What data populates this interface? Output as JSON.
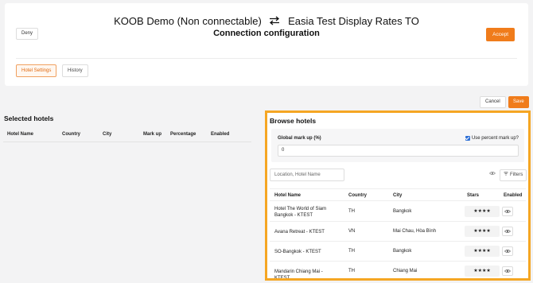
{
  "header": {
    "connection_from": "KOOB Demo (Non connectable)",
    "connection_to": "Easia Test Display Rates TO",
    "subtitle": "Connection configuration",
    "deny_label": "Deny",
    "accept_label": "Accept"
  },
  "tabs": [
    {
      "label": "Hotel Settings",
      "active": true
    },
    {
      "label": "History",
      "active": false
    }
  ],
  "actions": {
    "cancel_label": "Cancel",
    "save_label": "Save"
  },
  "selected_hotels": {
    "title": "Selected hotels",
    "columns": [
      "Hotel Name",
      "Country",
      "City",
      "Mark up",
      "Percentage",
      "Enabled"
    ]
  },
  "browse": {
    "title": "Browse hotels",
    "markup_label": "Global mark up (%)",
    "markup_value": "0",
    "use_percent_label": "Use percent mark up?",
    "use_percent_checked": true,
    "search_placeholder": "Location, Hotel Name",
    "filters_label": "Filters",
    "columns": [
      "Hotel Name",
      "Country",
      "City",
      "Stars",
      "Enabled"
    ],
    "rows": [
      {
        "name": "Hotel The World of Siam Bangkok - KTEST",
        "country": "TH",
        "city": "Bangkok",
        "stars": "★★★★"
      },
      {
        "name": "Avana Retreat - KTEST",
        "country": "VN",
        "city": "Mai Chau, Hòa Bình",
        "stars": "★★★★"
      },
      {
        "name": "SO-Bangkok - KTEST",
        "country": "TH",
        "city": "Bangkok",
        "stars": "★★★★"
      },
      {
        "name": "Mandarin Chiang Mai - KTEST",
        "country": "TH",
        "city": "Chiang Mai",
        "stars": "★★★★"
      }
    ]
  },
  "colors": {
    "accent": "#f07c1b",
    "highlight_border": "#f5a623",
    "star": "#f2c01d"
  },
  "icons": {
    "swap": "swap-arrows-icon",
    "eye": "eye-icon",
    "filter": "filter-icon"
  }
}
